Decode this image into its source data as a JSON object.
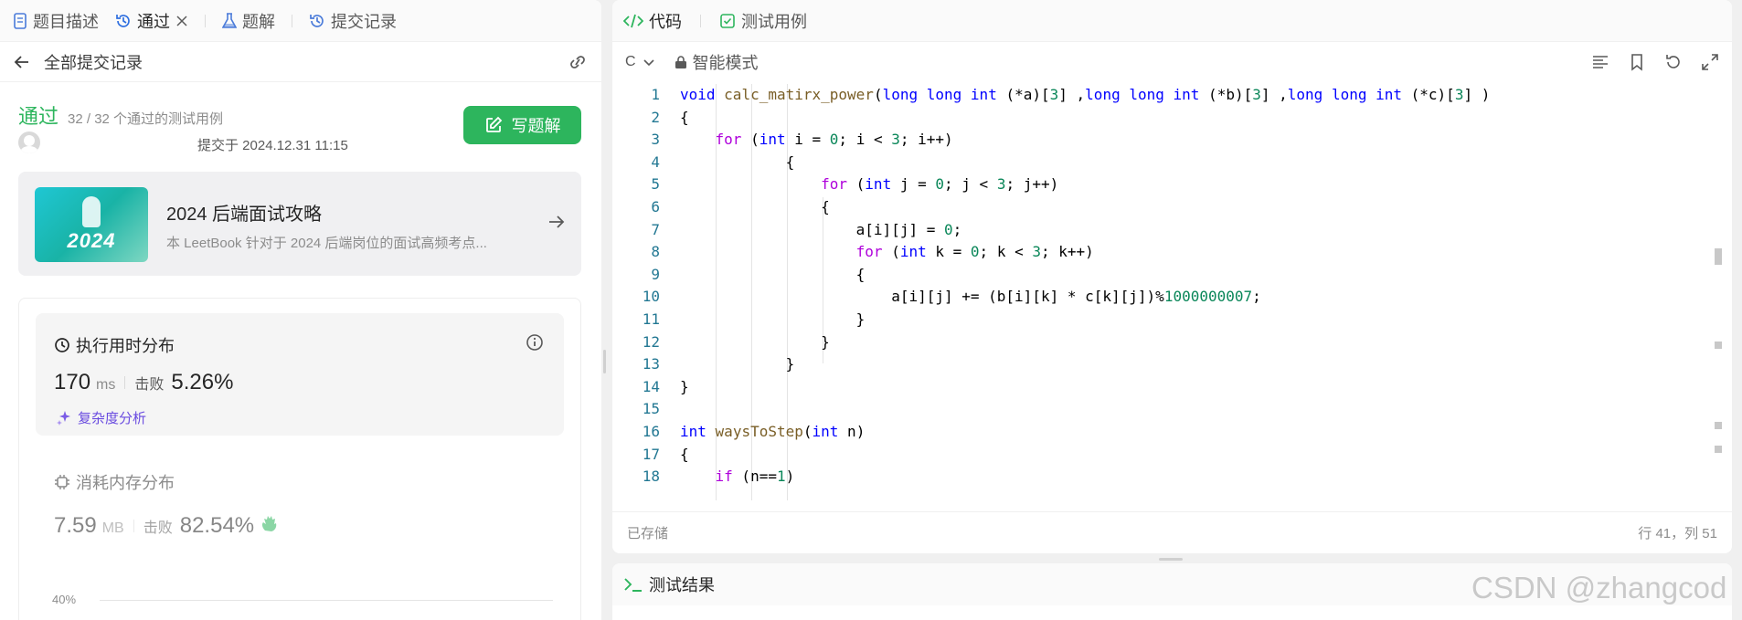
{
  "left_tabs": [
    {
      "label": "题目描述",
      "icon": "document-icon"
    },
    {
      "label": "通过",
      "icon": "history-icon",
      "closable": true
    },
    {
      "label": "题解",
      "icon": "flask-icon"
    },
    {
      "label": "提交记录",
      "icon": "history-icon"
    }
  ],
  "header": {
    "back_label": "全部提交记录"
  },
  "submission": {
    "status": "通过",
    "pass_text": "32 / 32 个通过的测试用例",
    "submitted_at": "提交于 2024.12.31 11:15",
    "write_button": "写题解"
  },
  "leetbook": {
    "cover_year": "2024",
    "title": "2024 后端面试攻略",
    "desc": "本 LeetBook 针对于 2024 后端岗位的面试高频考点..."
  },
  "runtime": {
    "heading": "执行用时分布",
    "value": "170",
    "unit": "ms",
    "beat_label": "击败",
    "beat_value": "5.26%",
    "complexity_link": "复杂度分析"
  },
  "memory": {
    "heading": "消耗内存分布",
    "value": "7.59",
    "unit": "MB",
    "beat_label": "击败",
    "beat_value": "82.54%"
  },
  "chart_axis": {
    "tick": "40%"
  },
  "code_tabs": [
    {
      "label": "代码",
      "icon": "code-icon"
    },
    {
      "label": "测试用例",
      "icon": "checkbox-icon"
    }
  ],
  "toolbar": {
    "language": "C",
    "mode": "智能模式"
  },
  "code_lines": [
    "void calc_matirx_power(long long int (*a)[3] ,long long int (*b)[3] ,long long int (*c)[3] )",
    "{",
    "    for (int i = 0; i < 3; i++)",
    "            {",
    "                for (int j = 0; j < 3; j++)",
    "                {",
    "                    a[i][j] = 0;",
    "                    for (int k = 0; k < 3; k++)",
    "                    {",
    "                        a[i][j] += (b[i][k] * c[k][j])%1000000007;",
    "                    }",
    "                }",
    "            }",
    "}",
    "",
    "int waysToStep(int n)",
    "{",
    "    if (n==1)"
  ],
  "footer": {
    "saved": "已存储",
    "cursor": "行 41，列 51"
  },
  "result_tab": {
    "label": "测试结果"
  },
  "watermark": "CSDN @zhangcod",
  "colors": {
    "accent_green": "#2db55d",
    "keyword": "#0000ff",
    "control": "#af00db",
    "function": "#795e26",
    "number": "#098658",
    "line_number": "#237893"
  }
}
